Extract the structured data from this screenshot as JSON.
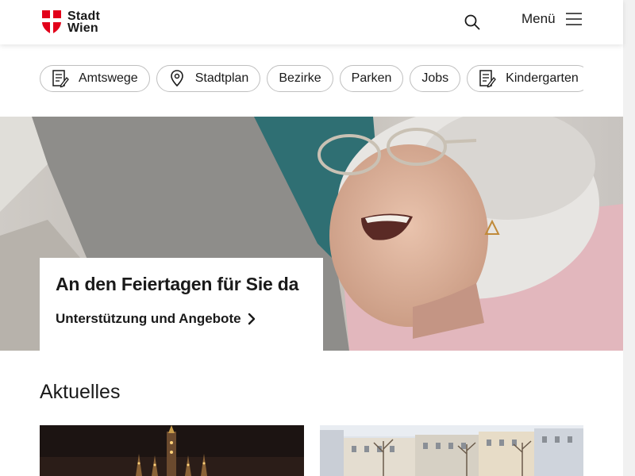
{
  "header": {
    "logo_line1": "Stadt",
    "logo_line2": "Wien",
    "menu_label": "Menü"
  },
  "quick_links": [
    {
      "label": "Amtswege",
      "icon": "form-icon"
    },
    {
      "label": "Stadtplan",
      "icon": "location-pin-icon"
    },
    {
      "label": "Bezirke"
    },
    {
      "label": "Parken"
    },
    {
      "label": "Jobs"
    },
    {
      "label": "Kindergarten",
      "icon": "form-icon"
    }
  ],
  "hero": {
    "title": "An den Feiertagen für Sie da",
    "link_label": "Unterstützung und Angebote"
  },
  "news": {
    "section_title": "Aktuelles"
  },
  "colors": {
    "brand_red": "#e2001a",
    "text": "#1a1a1a",
    "chip_border": "#bfbfbf"
  }
}
